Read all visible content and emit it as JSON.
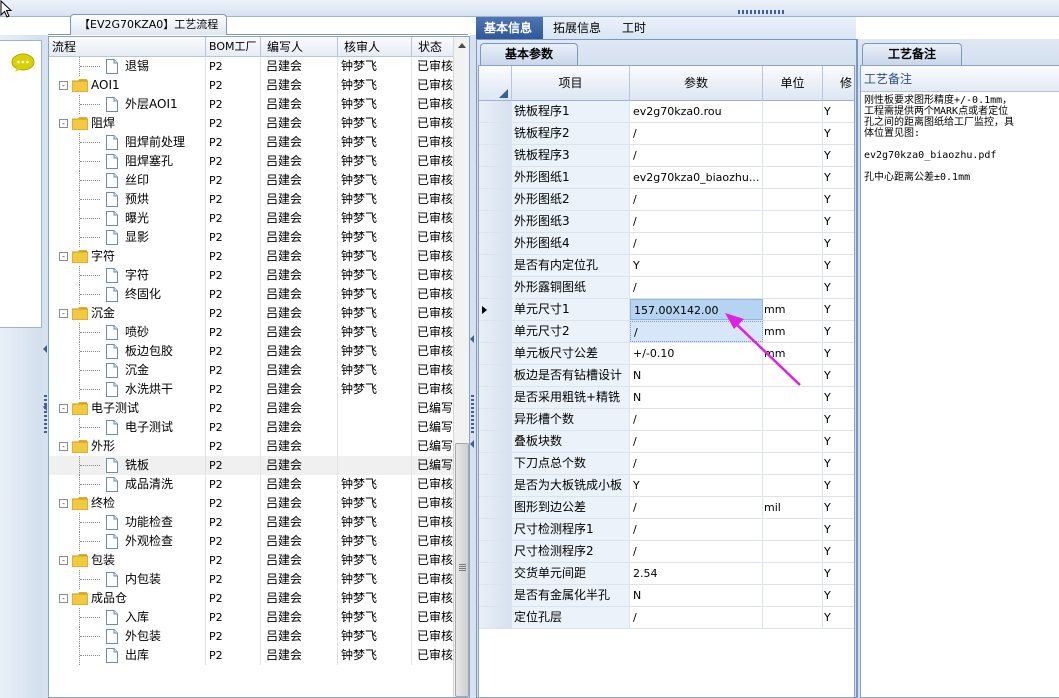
{
  "left_panel_tab": "【EV2G70KZA0】工艺流程",
  "tree": {
    "columns": [
      "流程",
      "BOM工厂",
      "编写人",
      "核审人",
      "状态"
    ],
    "rows": [
      {
        "label": "退锡",
        "type": "doc",
        "level": 1,
        "bom": "P2",
        "writer": "吕建会",
        "reviewer": "钟梦飞",
        "status": "已审核"
      },
      {
        "label": "AOI1",
        "type": "folder",
        "level": 0,
        "bom": "P2",
        "writer": "吕建会",
        "reviewer": "钟梦飞",
        "status": "已审核"
      },
      {
        "label": "外层AOI1",
        "type": "doc",
        "level": 1,
        "bom": "P2",
        "writer": "吕建会",
        "reviewer": "钟梦飞",
        "status": "已审核"
      },
      {
        "label": "阻焊",
        "type": "folder",
        "level": 0,
        "bom": "P2",
        "writer": "吕建会",
        "reviewer": "钟梦飞",
        "status": "已审核"
      },
      {
        "label": "阻焊前处理",
        "type": "doc",
        "level": 1,
        "bom": "P2",
        "writer": "吕建会",
        "reviewer": "钟梦飞",
        "status": "已审核"
      },
      {
        "label": "阻焊塞孔",
        "type": "doc",
        "level": 1,
        "bom": "P2",
        "writer": "吕建会",
        "reviewer": "钟梦飞",
        "status": "已审核"
      },
      {
        "label": "丝印",
        "type": "doc",
        "level": 1,
        "bom": "P2",
        "writer": "吕建会",
        "reviewer": "钟梦飞",
        "status": "已审核"
      },
      {
        "label": "预烘",
        "type": "doc",
        "level": 1,
        "bom": "P2",
        "writer": "吕建会",
        "reviewer": "钟梦飞",
        "status": "已审核"
      },
      {
        "label": "曝光",
        "type": "doc",
        "level": 1,
        "bom": "P2",
        "writer": "吕建会",
        "reviewer": "钟梦飞",
        "status": "已审核"
      },
      {
        "label": "显影",
        "type": "doc",
        "level": 1,
        "bom": "P2",
        "writer": "吕建会",
        "reviewer": "钟梦飞",
        "status": "已审核"
      },
      {
        "label": "字符",
        "type": "folder",
        "level": 0,
        "bom": "P2",
        "writer": "吕建会",
        "reviewer": "钟梦飞",
        "status": "已审核"
      },
      {
        "label": "字符",
        "type": "doc",
        "level": 1,
        "bom": "P2",
        "writer": "吕建会",
        "reviewer": "钟梦飞",
        "status": "已审核"
      },
      {
        "label": "终固化",
        "type": "doc",
        "level": 1,
        "bom": "P2",
        "writer": "吕建会",
        "reviewer": "钟梦飞",
        "status": "已审核"
      },
      {
        "label": "沉金",
        "type": "folder",
        "level": 0,
        "bom": "P2",
        "writer": "吕建会",
        "reviewer": "钟梦飞",
        "status": "已审核"
      },
      {
        "label": "喷砂",
        "type": "doc",
        "level": 1,
        "bom": "P2",
        "writer": "吕建会",
        "reviewer": "钟梦飞",
        "status": "已审核"
      },
      {
        "label": "板边包胶",
        "type": "doc",
        "level": 1,
        "bom": "P2",
        "writer": "吕建会",
        "reviewer": "钟梦飞",
        "status": "已审核"
      },
      {
        "label": "沉金",
        "type": "doc",
        "level": 1,
        "bom": "P2",
        "writer": "吕建会",
        "reviewer": "钟梦飞",
        "status": "已审核"
      },
      {
        "label": "水洗烘干",
        "type": "doc",
        "level": 1,
        "bom": "P2",
        "writer": "吕建会",
        "reviewer": "钟梦飞",
        "status": "已审核"
      },
      {
        "label": "电子测试",
        "type": "folder",
        "level": 0,
        "bom": "P2",
        "writer": "吕建会",
        "reviewer": "",
        "status": "已编写"
      },
      {
        "label": "电子测试",
        "type": "doc",
        "level": 1,
        "bom": "P2",
        "writer": "吕建会",
        "reviewer": "",
        "status": "已编写"
      },
      {
        "label": "外形",
        "type": "folder",
        "level": 0,
        "bom": "P2",
        "writer": "吕建会",
        "reviewer": "",
        "status": "已编写"
      },
      {
        "label": "铣板",
        "type": "doc",
        "level": 1,
        "bom": "P2",
        "writer": "吕建会",
        "reviewer": "",
        "status": "已编写",
        "selected": true
      },
      {
        "label": "成品清洗",
        "type": "doc",
        "level": 1,
        "bom": "P2",
        "writer": "吕建会",
        "reviewer": "钟梦飞",
        "status": "已审核"
      },
      {
        "label": "终检",
        "type": "folder",
        "level": 0,
        "bom": "P2",
        "writer": "吕建会",
        "reviewer": "钟梦飞",
        "status": "已审核"
      },
      {
        "label": "功能检查",
        "type": "doc",
        "level": 1,
        "bom": "P2",
        "writer": "吕建会",
        "reviewer": "钟梦飞",
        "status": "已审核"
      },
      {
        "label": "外观检查",
        "type": "doc",
        "level": 1,
        "bom": "P2",
        "writer": "吕建会",
        "reviewer": "钟梦飞",
        "status": "已审核"
      },
      {
        "label": "包装",
        "type": "folder",
        "level": 0,
        "bom": "P2",
        "writer": "吕建会",
        "reviewer": "钟梦飞",
        "status": "已审核"
      },
      {
        "label": "内包装",
        "type": "doc",
        "level": 1,
        "bom": "P2",
        "writer": "吕建会",
        "reviewer": "钟梦飞",
        "status": "已审核"
      },
      {
        "label": "成品仓",
        "type": "folder",
        "level": 0,
        "bom": "P2",
        "writer": "吕建会",
        "reviewer": "钟梦飞",
        "status": "已审核"
      },
      {
        "label": "入库",
        "type": "doc",
        "level": 1,
        "bom": "P2",
        "writer": "吕建会",
        "reviewer": "钟梦飞",
        "status": "已审核"
      },
      {
        "label": "外包装",
        "type": "doc",
        "level": 1,
        "bom": "P2",
        "writer": "吕建会",
        "reviewer": "钟梦飞",
        "status": "已审核"
      },
      {
        "label": "出库",
        "type": "doc",
        "level": 1,
        "bom": "P2",
        "writer": "吕建会",
        "reviewer": "钟梦飞",
        "status": "已审核"
      }
    ]
  },
  "main_tabs": [
    {
      "label": "基本信息",
      "active": true
    },
    {
      "label": "拓展信息",
      "active": false
    },
    {
      "label": "工时",
      "active": false
    }
  ],
  "sub_tab": "基本参数",
  "param_grid": {
    "columns": [
      "项目",
      "参数",
      "单位",
      "修"
    ],
    "rows": [
      {
        "item": "铣板程序1",
        "value": "ev2g70kza0.rou",
        "unit": "",
        "flag": "Y"
      },
      {
        "item": "铣板程序2",
        "value": "/",
        "unit": "",
        "flag": "Y"
      },
      {
        "item": "铣板程序3",
        "value": "/",
        "unit": "",
        "flag": "Y"
      },
      {
        "item": "外形图纸1",
        "value": "ev2g70kza0_biaozhu...",
        "unit": "",
        "flag": "Y"
      },
      {
        "item": "外形图纸2",
        "value": "/",
        "unit": "",
        "flag": "Y"
      },
      {
        "item": "外形图纸3",
        "value": "/",
        "unit": "",
        "flag": "Y"
      },
      {
        "item": "外形图纸4",
        "value": "/",
        "unit": "",
        "flag": "Y"
      },
      {
        "item": "是否有内定位孔",
        "value": "Y",
        "unit": "",
        "flag": "Y"
      },
      {
        "item": "外形露铜图纸",
        "value": "/",
        "unit": "",
        "flag": "Y"
      },
      {
        "item": "单元尺寸1",
        "value": "157.00X142.00",
        "unit": "mm",
        "flag": "Y",
        "current": true
      },
      {
        "item": "单元尺寸2",
        "value": "/",
        "unit": "mm",
        "flag": "Y",
        "focus": true
      },
      {
        "item": "单元板尺寸公差",
        "value": "+/-0.10",
        "unit": "mm",
        "flag": "Y"
      },
      {
        "item": "板边是否有钻槽设计",
        "value": "N",
        "unit": "",
        "flag": "Y"
      },
      {
        "item": "是否采用粗铣+精铣",
        "value": "N",
        "unit": "",
        "flag": "Y"
      },
      {
        "item": "异形槽个数",
        "value": "/",
        "unit": "",
        "flag": "Y"
      },
      {
        "item": "叠板块数",
        "value": "/",
        "unit": "",
        "flag": "Y"
      },
      {
        "item": "下刀点总个数",
        "value": "/",
        "unit": "",
        "flag": "Y"
      },
      {
        "item": "是否为大板铣成小板",
        "value": "Y",
        "unit": "",
        "flag": "Y"
      },
      {
        "item": "图形到边公差",
        "value": "/",
        "unit": "mil",
        "flag": "Y"
      },
      {
        "item": "尺寸检测程序1",
        "value": "/",
        "unit": "",
        "flag": "Y"
      },
      {
        "item": "尺寸检测程序2",
        "value": "/",
        "unit": "",
        "flag": "Y"
      },
      {
        "item": "交货单元间距",
        "value": "2.54",
        "unit": "",
        "flag": "Y"
      },
      {
        "item": "是否有金属化半孔",
        "value": "N",
        "unit": "",
        "flag": "Y"
      },
      {
        "item": "定位孔层",
        "value": "/",
        "unit": "",
        "flag": "Y"
      }
    ]
  },
  "notes_panel": {
    "tab": "工艺备注",
    "header": "工艺备注",
    "lines": [
      "刚性板要求图形精度+/-0.1mm，",
      "工程需提供两个MARK点或者定位",
      "孔之间的距离图纸给工厂监控，具",
      "体位置见图:",
      "",
      "ev2g70kza0_biaozhu.pdf",
      "",
      "孔中心距离公差±0.1mm"
    ]
  },
  "colors": {
    "active_tab": "#3a63a6",
    "selected_cell": "#b7d3f2",
    "annotation_arrow": "#e020e0",
    "bubble": "#d8d000"
  },
  "icons": {
    "chat": "speech-bubble-icon",
    "folder": "folder-icon",
    "doc": "document-icon",
    "cursor": "mouse-cursor-icon"
  }
}
